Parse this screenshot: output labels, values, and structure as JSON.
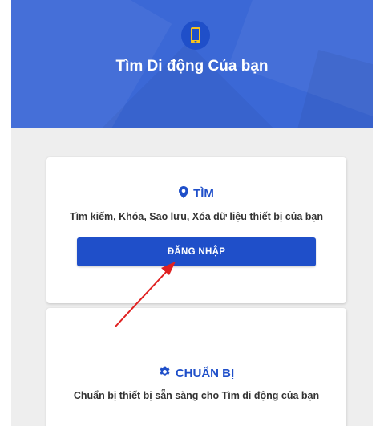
{
  "hero": {
    "title": "Tìm Di động Của bạn",
    "icon": "mobile-phone-icon",
    "background_color": "#3b68d6"
  },
  "cards": {
    "find": {
      "icon": "location-pin-icon",
      "heading": "TÌM",
      "description": "Tìm kiếm, Khóa, Sao lưu, Xóa dữ liệu thiết bị của bạn",
      "button_label": "ĐĂNG NHẬP"
    },
    "prepare": {
      "icon": "gear-icon",
      "heading": "CHUẨN BỊ",
      "description": "Chuẩn bị thiết bị sẵn sàng cho Tìm di động của bạn"
    }
  },
  "annotation": {
    "icon": "red-arrow-annotation",
    "color": "#e02020"
  },
  "colors": {
    "accent": "#1f4fc9",
    "content_background": "#eeeeee"
  }
}
